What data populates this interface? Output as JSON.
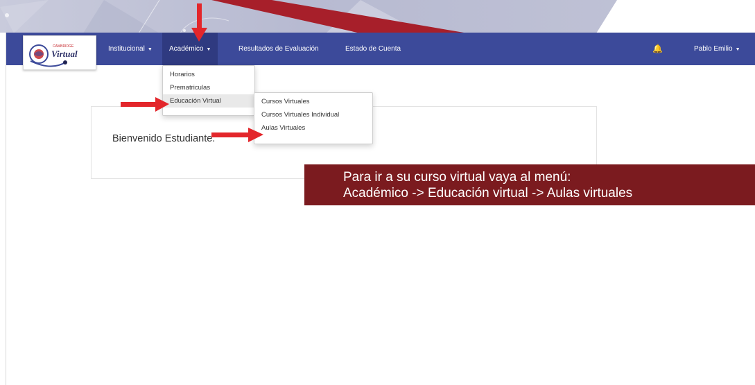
{
  "navbar": {
    "logo": {
      "top_text": "CAMBRIDGE",
      "main_text": "Virtual"
    },
    "items": [
      {
        "label": "Institucional",
        "has_caret": true
      },
      {
        "label": "Académico",
        "has_caret": true
      },
      {
        "label": "Resultados de Evaluación",
        "has_caret": false
      },
      {
        "label": "Estado de Cuenta",
        "has_caret": false
      }
    ],
    "user": {
      "name": "Pablo Emilio",
      "icon": "bell-icon"
    }
  },
  "academico_menu": [
    "Horarios",
    "Prematriculas",
    "Educación Virtual"
  ],
  "educacion_virtual_menu": [
    "Cursos Virtuales",
    "Cursos Virtuales Individual",
    "Aulas Virtuales"
  ],
  "welcome": {
    "text": "Bienvenido Estudiante."
  },
  "instruction": {
    "line1": "Para ir a su curso virtual vaya al menú:",
    "line2": "Académico -> Educación virtual -> Aulas virtuales"
  },
  "colors": {
    "navbar": "#3c4a9a",
    "instruction_bg": "#7b1b1f",
    "arrow": "#e3262b"
  }
}
